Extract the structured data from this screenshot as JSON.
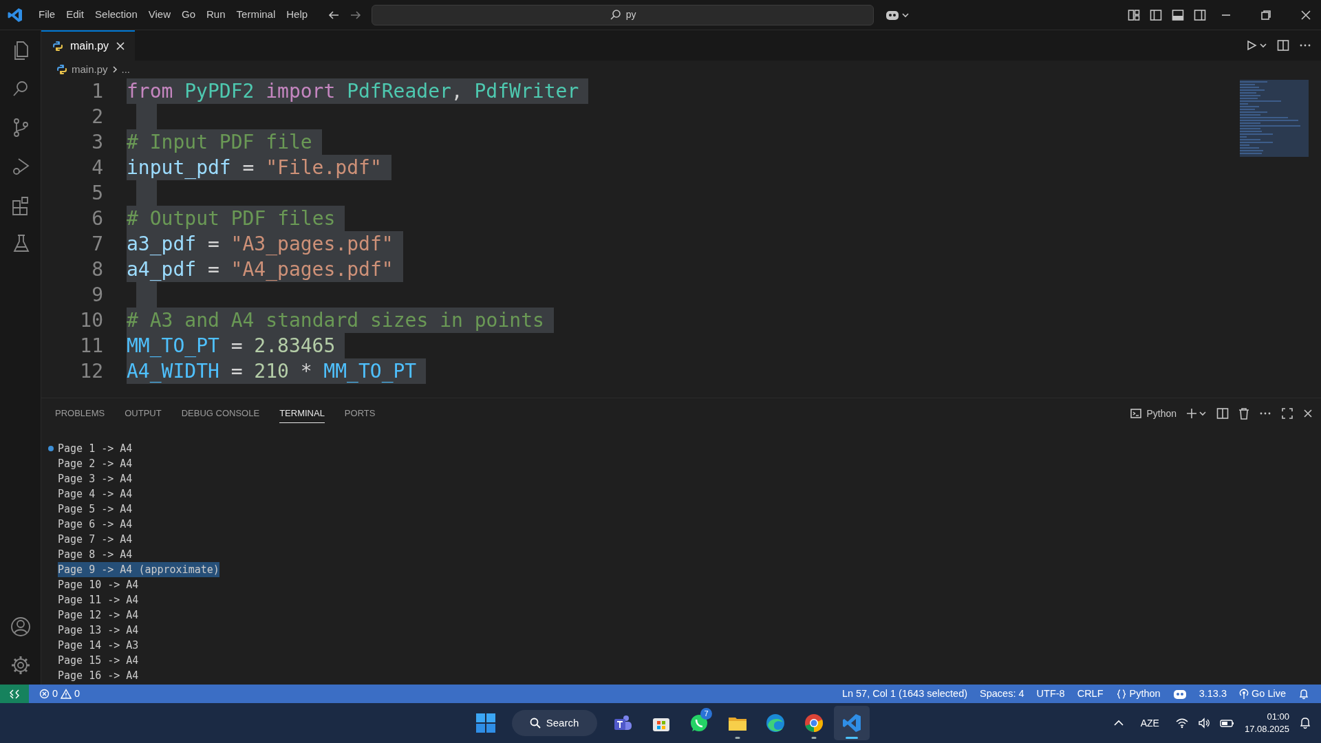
{
  "menu": [
    "File",
    "Edit",
    "Selection",
    "View",
    "Go",
    "Run",
    "Terminal",
    "Help"
  ],
  "command_center": {
    "value": "py"
  },
  "editor_tabs": [
    {
      "label": "main.py",
      "selected": true
    }
  ],
  "breadcrumbs": [
    "main.py",
    "..."
  ],
  "code_lines": [
    {
      "number": "1",
      "selected": true,
      "tokens": [
        {
          "text": "from",
          "kind": "keyword"
        },
        {
          "text": "PyPDF2",
          "kind": "module"
        },
        {
          "text": "import",
          "kind": "keyword"
        },
        {
          "text": "PdfReader",
          "kind": "module"
        },
        {
          "text": ",",
          "kind": "punct"
        },
        {
          "text": "PdfWriter",
          "kind": "module"
        }
      ]
    },
    {
      "number": "2",
      "selected": true
    },
    {
      "number": "3",
      "selected": true,
      "tokens": [
        {
          "text": "# Input PDF file",
          "kind": "comment"
        }
      ]
    },
    {
      "number": "4",
      "selected": true,
      "tokens": [
        {
          "text": "input_pdf",
          "kind": "variable"
        },
        {
          "text": "=",
          "kind": "operator"
        },
        {
          "text": "\"File.pdf\"",
          "kind": "string"
        }
      ]
    },
    {
      "number": "5",
      "selected": true
    },
    {
      "number": "6",
      "selected": true,
      "tokens": [
        {
          "text": "# Output PDF files",
          "kind": "comment"
        }
      ]
    },
    {
      "number": "7",
      "selected": true,
      "tokens": [
        {
          "text": "a3_pdf",
          "kind": "variable"
        },
        {
          "text": "=",
          "kind": "operator"
        },
        {
          "text": "\"A3_pages.pdf\"",
          "kind": "string"
        }
      ]
    },
    {
      "number": "8",
      "selected": true,
      "tokens": [
        {
          "text": "a4_pdf",
          "kind": "variable"
        },
        {
          "text": "=",
          "kind": "operator"
        },
        {
          "text": "\"A4_pages.pdf\"",
          "kind": "string"
        }
      ]
    },
    {
      "number": "9",
      "selected": true
    },
    {
      "number": "10",
      "selected": true,
      "tokens": [
        {
          "text": "# A3 and A4 standard sizes in points",
          "kind": "comment"
        }
      ]
    },
    {
      "number": "11",
      "selected": true,
      "tokens": [
        {
          "text": "MM_TO_PT",
          "kind": "constant"
        },
        {
          "text": "=",
          "kind": "operator"
        },
        {
          "text": "2.83465",
          "kind": "number"
        }
      ]
    },
    {
      "number": "12",
      "selected": true,
      "tokens": [
        {
          "text": "A4_WIDTH",
          "kind": "constant"
        },
        {
          "text": "=",
          "kind": "operator"
        },
        {
          "text": "210",
          "kind": "number"
        },
        {
          "text": "*",
          "kind": "operator"
        },
        {
          "text": "MM_TO_PT",
          "kind": "constant"
        }
      ]
    }
  ],
  "panel_tabs": [
    {
      "label": "PROBLEMS",
      "selected": false
    },
    {
      "label": "OUTPUT",
      "selected": false
    },
    {
      "label": "DEBUG CONSOLE",
      "selected": false
    },
    {
      "label": "TERMINAL",
      "selected": true
    },
    {
      "label": "PORTS",
      "selected": false
    }
  ],
  "terminal_profile": "Python",
  "terminal_lines": [
    {
      "text": "Page 1 -> A4",
      "selected": false
    },
    {
      "text": "Page 2 -> A4",
      "selected": false
    },
    {
      "text": "Page 3 -> A4",
      "selected": false
    },
    {
      "text": "Page 4 -> A4",
      "selected": false
    },
    {
      "text": "Page 5 -> A4",
      "selected": false
    },
    {
      "text": "Page 6 -> A4",
      "selected": false
    },
    {
      "text": "Page 7 -> A4",
      "selected": false
    },
    {
      "text": "Page 8 -> A4",
      "selected": false
    },
    {
      "text": "Page 9 -> A4 (approximate)",
      "selected": true
    },
    {
      "text": "Page 10 -> A4",
      "selected": false
    },
    {
      "text": "Page 11 -> A4",
      "selected": false
    },
    {
      "text": "Page 12 -> A4",
      "selected": false
    },
    {
      "text": "Page 13 -> A4",
      "selected": false
    },
    {
      "text": "Page 14 -> A3",
      "selected": false
    },
    {
      "text": "Page 15 -> A4",
      "selected": false
    },
    {
      "text": "Page 16 -> A4",
      "selected": false
    }
  ],
  "status_bar": {
    "errors": "0",
    "warnings": "0",
    "items": [
      {
        "kind": "plain",
        "text": "Ln 57, Col 1 (1643 selected)"
      },
      {
        "kind": "plain",
        "text": "Spaces: 4"
      },
      {
        "kind": "plain",
        "text": "UTF-8"
      },
      {
        "kind": "plain",
        "text": "CRLF"
      },
      {
        "kind": "braces",
        "text": "Python"
      },
      {
        "kind": "copilot"
      },
      {
        "kind": "plain",
        "text": "3.13.3"
      },
      {
        "kind": "broadcast",
        "text": "Go Live"
      },
      {
        "kind": "bell"
      }
    ]
  },
  "taskbar": {
    "search_label": "Search",
    "apps": [
      {
        "kind": "teams",
        "running": false,
        "selected": false
      },
      {
        "kind": "store",
        "running": false,
        "selected": false
      },
      {
        "kind": "whatsapp",
        "running": false,
        "selected": false,
        "badge": "7"
      },
      {
        "kind": "explorer",
        "running": true,
        "selected": false
      },
      {
        "kind": "edge",
        "running": false,
        "selected": false
      },
      {
        "kind": "chrome",
        "running": true,
        "selected": false
      },
      {
        "kind": "vscode",
        "running": true,
        "selected": true
      }
    ]
  },
  "tray": {
    "language": "AZE",
    "time": "01:00",
    "date": "17.08.2025"
  }
}
